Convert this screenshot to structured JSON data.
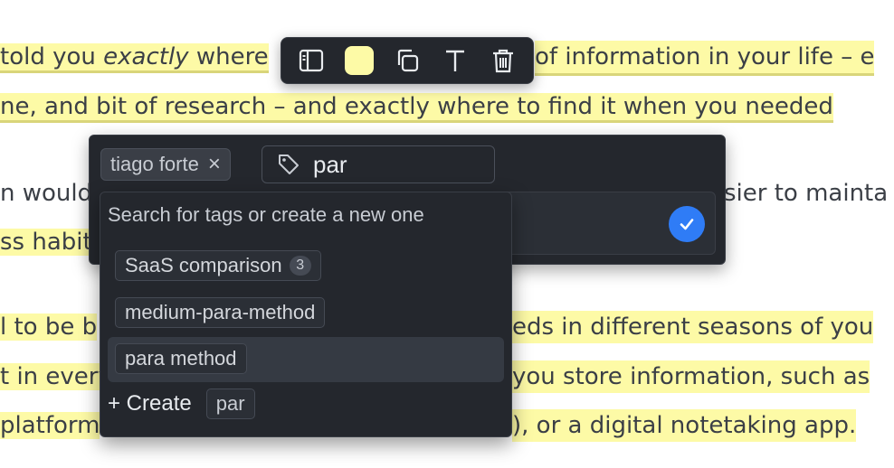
{
  "document": {
    "line1": {
      "a": " told you ",
      "b": "exactly",
      "c": " where",
      "d": "of information in your life – e"
    },
    "line2": "ne, and bit of research – and exactly where to find it when you needed",
    "line3a": "n would",
    "line3b": "sier to mainta",
    "line4": "ss habit",
    "line5a": "l to be b",
    "line5b": "eds in different seasons of you",
    "line6a": "t in every",
    "line6b": "you store information, such as",
    "line7a": " platform",
    "line7b": "), or a digital notetaking app."
  },
  "toolbar": {
    "highlight_color": "#fdfaa6",
    "icons": [
      "sidebar-icon",
      "copy-icon",
      "text-icon",
      "trash-icon"
    ]
  },
  "tag_panel": {
    "chips": [
      {
        "label": "tiago forte"
      }
    ],
    "input_value": "par",
    "accent": "#2f7cf6"
  },
  "dropdown": {
    "hint": "Search for tags or create a new one",
    "items": [
      {
        "label": "SaaS comparison",
        "count": "3"
      },
      {
        "label": "medium-para-method"
      },
      {
        "label": "para method"
      }
    ],
    "create_label": "+ Create",
    "create_query": "par"
  }
}
